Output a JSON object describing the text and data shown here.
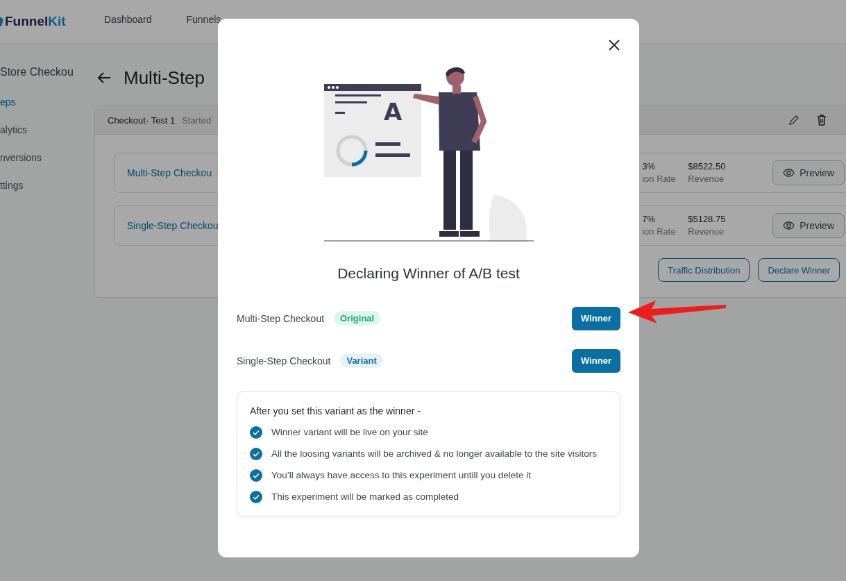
{
  "header": {
    "logo": [
      "Funnel",
      "Kit"
    ],
    "nav": [
      {
        "label": "Dashboard",
        "selected": false
      },
      {
        "label": "Funnels",
        "selected": false
      }
    ]
  },
  "sidebar": {
    "title": "Store Checkou",
    "items": [
      {
        "label": "eps",
        "selected": true
      },
      {
        "label": "alytics",
        "selected": false
      },
      {
        "label": "nversions",
        "selected": false
      },
      {
        "label": "ttings",
        "selected": false
      }
    ]
  },
  "page": {
    "title": "Multi-Step"
  },
  "experiment": {
    "name": "Checkout- Test 1",
    "status": "Started",
    "variants": [
      {
        "name": "Multi-Step Checkou",
        "rate": "3%",
        "rate_label": "ion Rate",
        "revenue": "$8522.50",
        "revenue_label": "Revenue",
        "preview": "Preview"
      },
      {
        "name": "Single-Step Checkou",
        "rate": "7%",
        "rate_label": "ion Rate",
        "revenue": "$5128.75",
        "revenue_label": "Revenue",
        "preview": "Preview"
      }
    ],
    "actions": [
      "Traffic Distribution",
      "Declare Winner"
    ]
  },
  "modal": {
    "illustration_letter": "A",
    "title": "Declaring Winner of A/B test",
    "variants": [
      {
        "name": "Multi-Step Checkout",
        "badge": "Original",
        "kind": "original",
        "button": "Winner"
      },
      {
        "name": "Single-Step Checkout",
        "badge": "Variant",
        "kind": "variant",
        "button": "Winner"
      }
    ],
    "info": {
      "heading": "After you set this variant as the winner -",
      "points": [
        "Winner variant will be live on your site",
        "All the loosing variants will be archived & no longer available to the site visitors",
        "You’ll always have access to this experiment untill you delete it",
        "This experiment will be marked as completed"
      ]
    }
  }
}
